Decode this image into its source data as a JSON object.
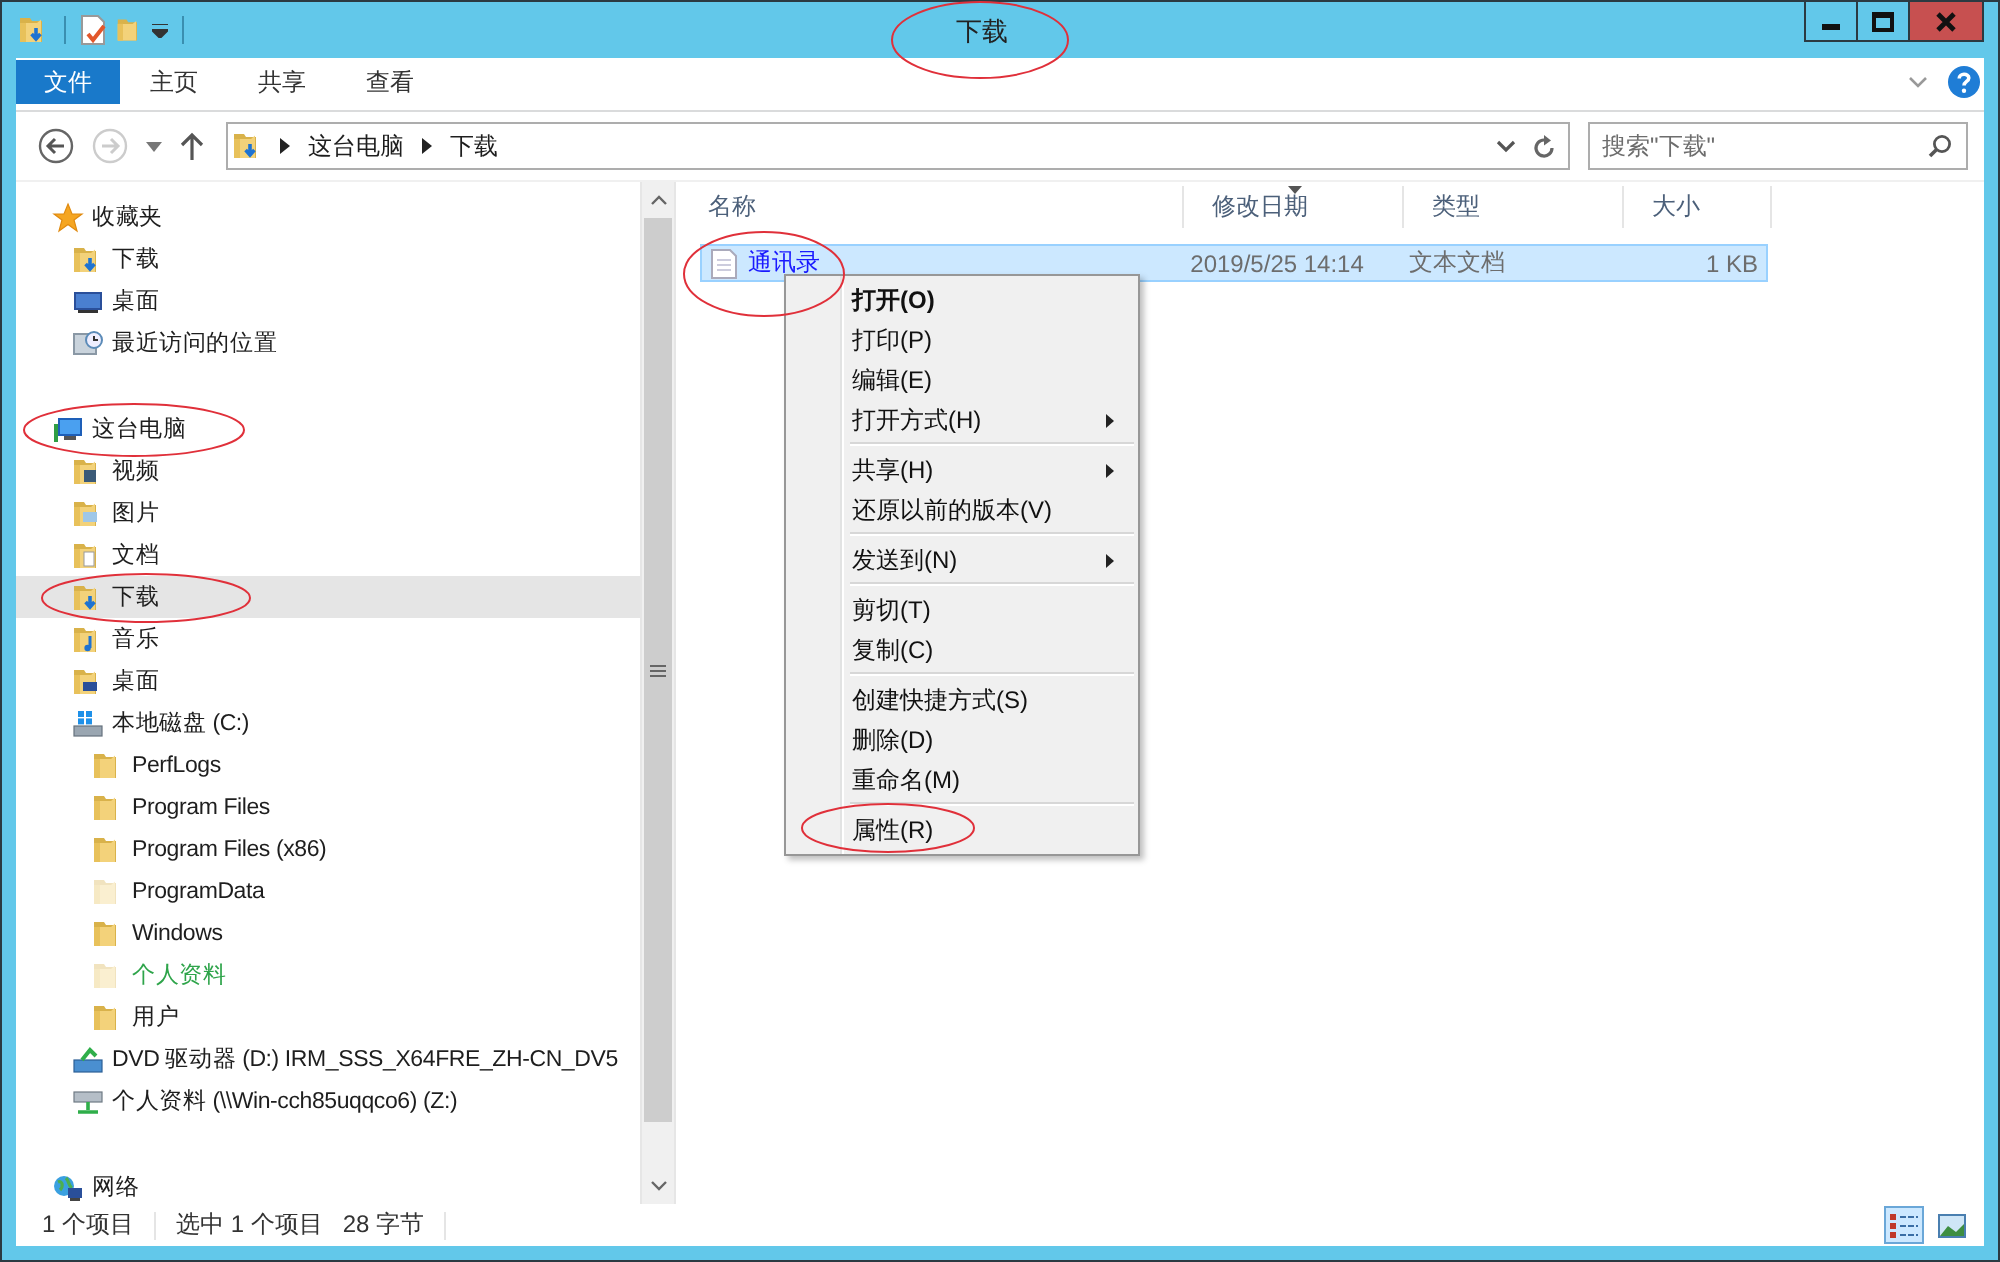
{
  "window": {
    "title": "下载"
  },
  "ribbon": {
    "tabs": [
      {
        "label": "文件",
        "kind": "file"
      },
      {
        "label": "主页",
        "kind": "tab"
      },
      {
        "label": "共享",
        "kind": "tab"
      },
      {
        "label": "查看",
        "kind": "tab"
      }
    ]
  },
  "address": {
    "breadcrumbs": [
      "这台电脑",
      "下载"
    ]
  },
  "search": {
    "placeholder": "搜索\"下载\""
  },
  "nav": {
    "items": [
      {
        "label": "收藏夹",
        "kind": "favorites",
        "selected": false,
        "hidden": false,
        "encrypted": false,
        "children": [
          {
            "label": "下载",
            "kind": "downloads",
            "selected": false,
            "hidden": false,
            "encrypted": false
          },
          {
            "label": "桌面",
            "kind": "desktop",
            "selected": false,
            "hidden": false,
            "encrypted": false
          },
          {
            "label": "最近访问的位置",
            "kind": "recent",
            "selected": false,
            "hidden": false,
            "encrypted": false
          }
        ]
      },
      {
        "label": "这台电脑",
        "kind": "computer",
        "selected": false,
        "hidden": false,
        "encrypted": false,
        "children": [
          {
            "label": "视频",
            "kind": "videos",
            "selected": false,
            "hidden": false,
            "encrypted": false
          },
          {
            "label": "图片",
            "kind": "pictures",
            "selected": false,
            "hidden": false,
            "encrypted": false
          },
          {
            "label": "文档",
            "kind": "documents",
            "selected": false,
            "hidden": false,
            "encrypted": false
          },
          {
            "label": "下载",
            "kind": "downloads",
            "selected": true,
            "hidden": false,
            "encrypted": false
          },
          {
            "label": "音乐",
            "kind": "music",
            "selected": false,
            "hidden": false,
            "encrypted": false
          },
          {
            "label": "桌面",
            "kind": "desktop-folder",
            "selected": false,
            "hidden": false,
            "encrypted": false
          },
          {
            "label": "本地磁盘 (C:)",
            "kind": "drive",
            "selected": false,
            "hidden": false,
            "encrypted": false,
            "children": [
              {
                "label": "PerfLogs",
                "kind": "folder",
                "selected": false,
                "hidden": false,
                "encrypted": false
              },
              {
                "label": "Program Files",
                "kind": "folder",
                "selected": false,
                "hidden": false,
                "encrypted": false
              },
              {
                "label": "Program Files (x86)",
                "kind": "folder",
                "selected": false,
                "hidden": false,
                "encrypted": false
              },
              {
                "label": "ProgramData",
                "kind": "folder",
                "selected": false,
                "hidden": true,
                "encrypted": false
              },
              {
                "label": "Windows",
                "kind": "folder",
                "selected": false,
                "hidden": false,
                "encrypted": false
              },
              {
                "label": "个人资料",
                "kind": "folder",
                "selected": false,
                "hidden": true,
                "encrypted": true
              },
              {
                "label": "用户",
                "kind": "folder",
                "selected": false,
                "hidden": false,
                "encrypted": false
              }
            ]
          },
          {
            "label": "DVD 驱动器 (D:) IRM_SSS_X64FRE_ZH-CN_DV5",
            "kind": "dvd",
            "selected": false,
            "hidden": false,
            "encrypted": false
          },
          {
            "label": "个人资料 (\\\\Win-cch85uqqco6) (Z:)",
            "kind": "network-drive",
            "selected": false,
            "hidden": false,
            "encrypted": false
          }
        ]
      },
      {
        "label": "网络",
        "kind": "network",
        "selected": false,
        "hidden": false,
        "encrypted": false
      }
    ]
  },
  "files": {
    "columns": [
      {
        "label": "名称",
        "sorted": false
      },
      {
        "label": "修改日期",
        "sorted": true
      },
      {
        "label": "类型",
        "sorted": false
      },
      {
        "label": "大小",
        "sorted": false
      }
    ],
    "rows": [
      {
        "name": "通讯录",
        "date": "2019/5/25 14:14",
        "type": "文本文档",
        "size": "1 KB",
        "selected": true,
        "compressed": true
      }
    ]
  },
  "context_menu": {
    "groups": [
      [
        {
          "label": "打开(O)",
          "default": true,
          "submenu": false
        },
        {
          "label": "打印(P)",
          "default": false,
          "submenu": false
        },
        {
          "label": "编辑(E)",
          "default": false,
          "submenu": false
        },
        {
          "label": "打开方式(H)",
          "default": false,
          "submenu": true
        }
      ],
      [
        {
          "label": "共享(H)",
          "default": false,
          "submenu": true
        },
        {
          "label": "还原以前的版本(V)",
          "default": false,
          "submenu": false
        }
      ],
      [
        {
          "label": "发送到(N)",
          "default": false,
          "submenu": true
        }
      ],
      [
        {
          "label": "剪切(T)",
          "default": false,
          "submenu": false
        },
        {
          "label": "复制(C)",
          "default": false,
          "submenu": false
        }
      ],
      [
        {
          "label": "创建快捷方式(S)",
          "default": false,
          "submenu": false
        },
        {
          "label": "删除(D)",
          "default": false,
          "submenu": false
        },
        {
          "label": "重命名(M)",
          "default": false,
          "submenu": false
        }
      ],
      [
        {
          "label": "属性(R)",
          "default": false,
          "submenu": false
        }
      ]
    ]
  },
  "status_bar": {
    "item_count": "1 个项目",
    "selection": "选中 1 个项目",
    "selection_size": "28 字节",
    "views": [
      {
        "kind": "details",
        "selected": true
      },
      {
        "kind": "large-icons",
        "selected": false
      }
    ]
  }
}
